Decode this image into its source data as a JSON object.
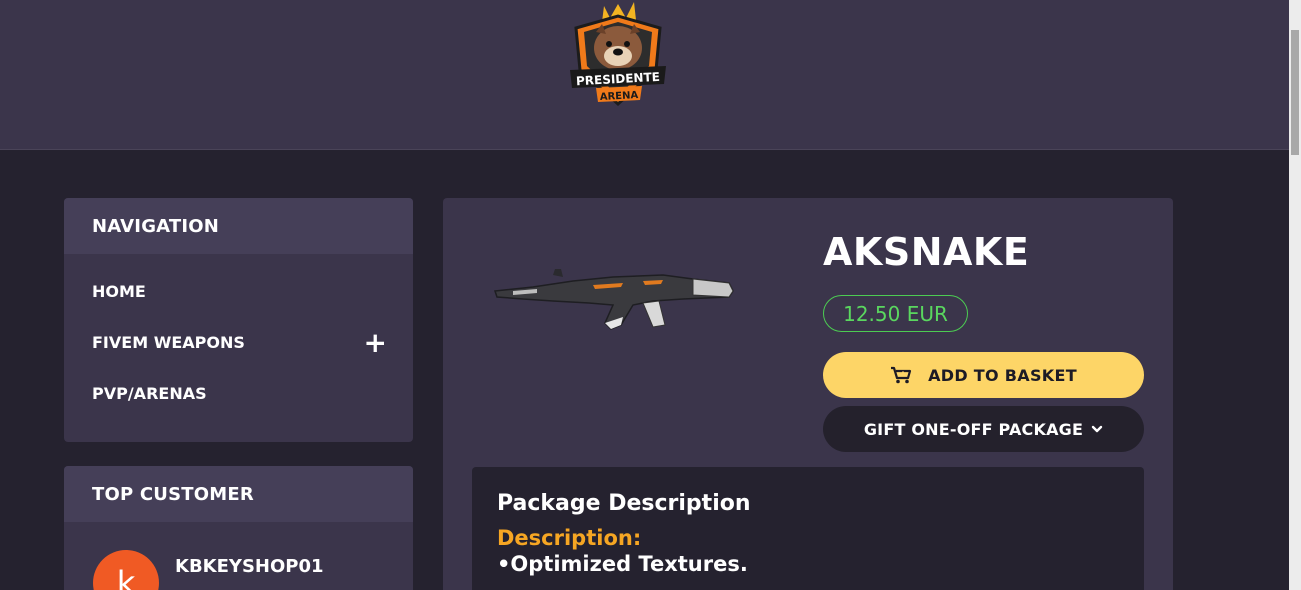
{
  "brand": {
    "logo_line1": "PRESIDENTE",
    "logo_line2": "ARENA"
  },
  "navigation": {
    "title": "NAVIGATION",
    "items": [
      {
        "label": "HOME"
      },
      {
        "label": "FIVEM WEAPONS",
        "has_plus": true
      },
      {
        "label": "PVP/ARENAS"
      }
    ]
  },
  "top_customer": {
    "title": "TOP CUSTOMER",
    "avatar_letter": "k",
    "name": "KBKEYSHOP01"
  },
  "product": {
    "title": "AKSNAKE",
    "price": "12.50 EUR",
    "add_to_basket_label": "ADD TO BASKET",
    "gift_label": "GIFT ONE-OFF PACKAGE"
  },
  "description": {
    "heading": "Package Description",
    "subheading": "Description:",
    "line1": "•Optimized Textures."
  },
  "colors": {
    "header_bg": "#3b354b",
    "page_bg": "#25222f",
    "panel_bg": "#3b354b",
    "panel_head_bg": "#453f58",
    "price_green": "#5ad75f",
    "basket_yellow": "#fdd567",
    "desc_orange": "#f6a623",
    "avatar_orange": "#f05a24"
  }
}
